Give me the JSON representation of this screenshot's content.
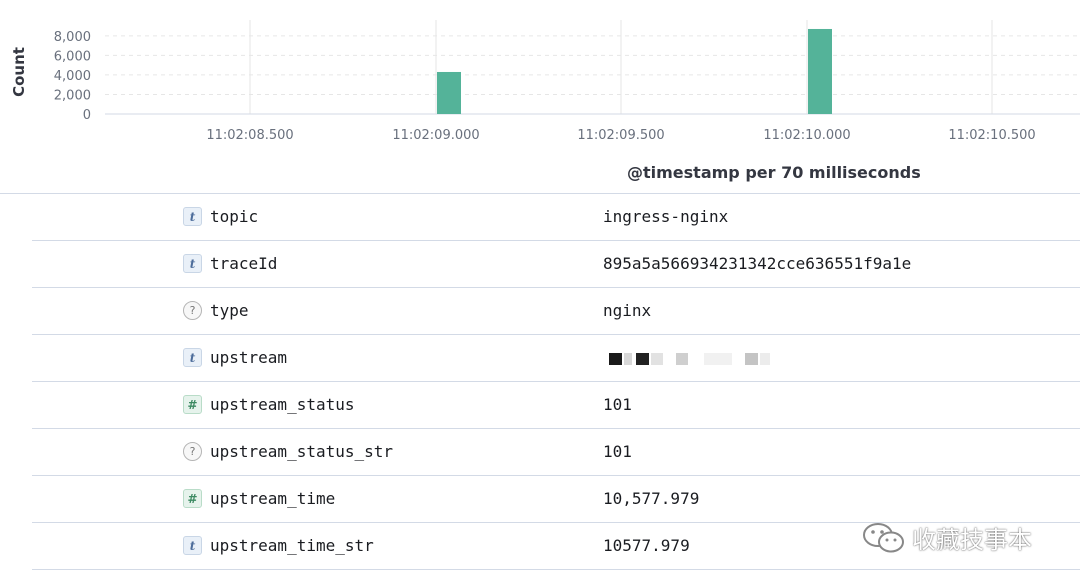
{
  "chart_data": {
    "type": "bar",
    "ylabel": "Count",
    "xlabel": "@timestamp per 70 milliseconds",
    "yticks": [
      "0",
      "2,000",
      "4,000",
      "6,000",
      "8,000"
    ],
    "ylim": [
      0,
      8800
    ],
    "xticks": [
      "11:02:08.500",
      "11:02:09.000",
      "11:02:09.500",
      "11:02:10.000",
      "11:02:10.500"
    ],
    "x": [
      "11:02:09.000",
      "11:02:10.000"
    ],
    "values": [
      4300,
      8700
    ],
    "grid": true,
    "color": "#54b399"
  },
  "fields": [
    {
      "type": "t",
      "name": "topic",
      "value": "ingress-nginx"
    },
    {
      "type": "t",
      "name": "traceId",
      "value": "895a5a566934231342cce636551f9a1e"
    },
    {
      "type": "?",
      "name": "type",
      "value": "nginx"
    },
    {
      "type": "t",
      "name": "upstream",
      "value": ""
    },
    {
      "type": "#",
      "name": "upstream_status",
      "value": "101"
    },
    {
      "type": "?",
      "name": "upstream_status_str",
      "value": "101"
    },
    {
      "type": "#",
      "name": "upstream_time",
      "value": "10,577.979"
    },
    {
      "type": "t",
      "name": "upstream_time_str",
      "value": "10577.979"
    }
  ],
  "watermark": {
    "text": "收藏技事本",
    "icon": "wechat-icon"
  }
}
